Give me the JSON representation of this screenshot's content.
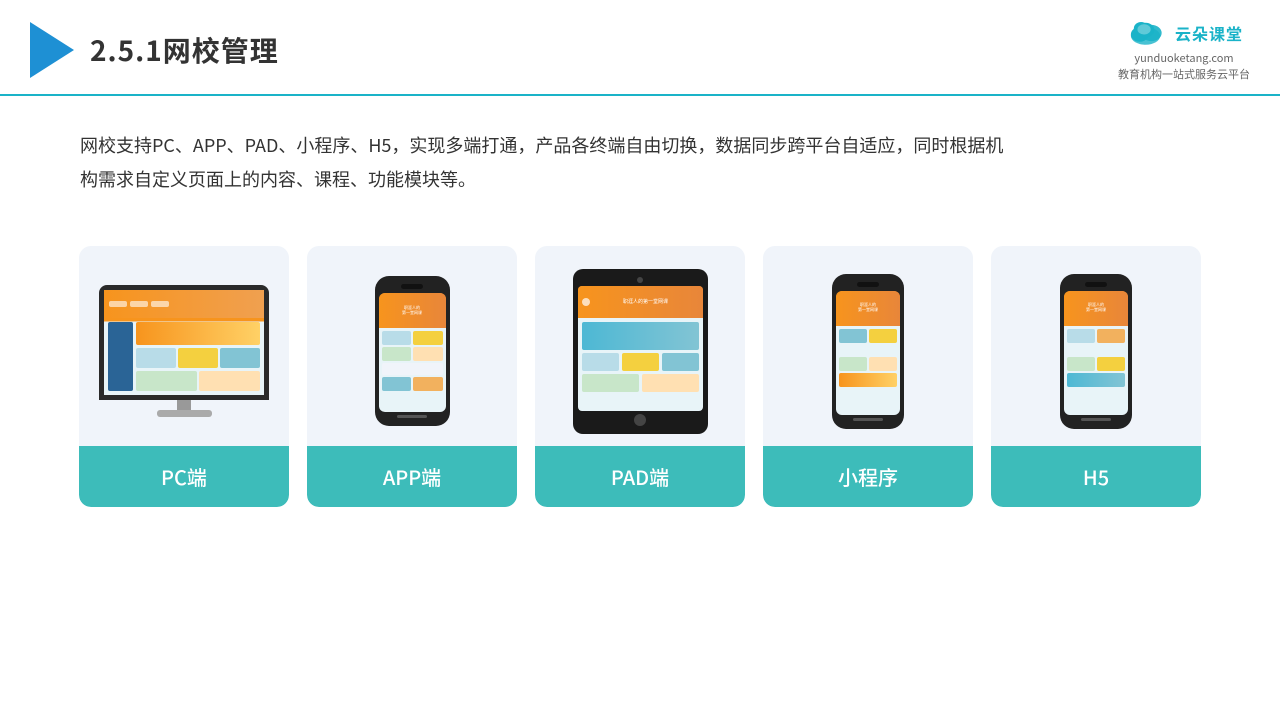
{
  "header": {
    "title": "2.5.1网校管理",
    "brand": {
      "name": "云朵课堂",
      "domain": "yunduoketang.com",
      "tagline": "教育机构一站\n式服务云平台"
    }
  },
  "description": {
    "text": "网校支持PC、APP、PAD、小程序、H5，实现多端打通，产品各终端自由切换，数据同步跨平台自适应，同时根据机构需求自定义页面上的内容、课程、功能模块等。"
  },
  "cards": [
    {
      "label": "PC端",
      "type": "pc"
    },
    {
      "label": "APP端",
      "type": "phone"
    },
    {
      "label": "PAD端",
      "type": "tablet"
    },
    {
      "label": "小程序",
      "type": "phone"
    },
    {
      "label": "H5",
      "type": "phone"
    }
  ]
}
